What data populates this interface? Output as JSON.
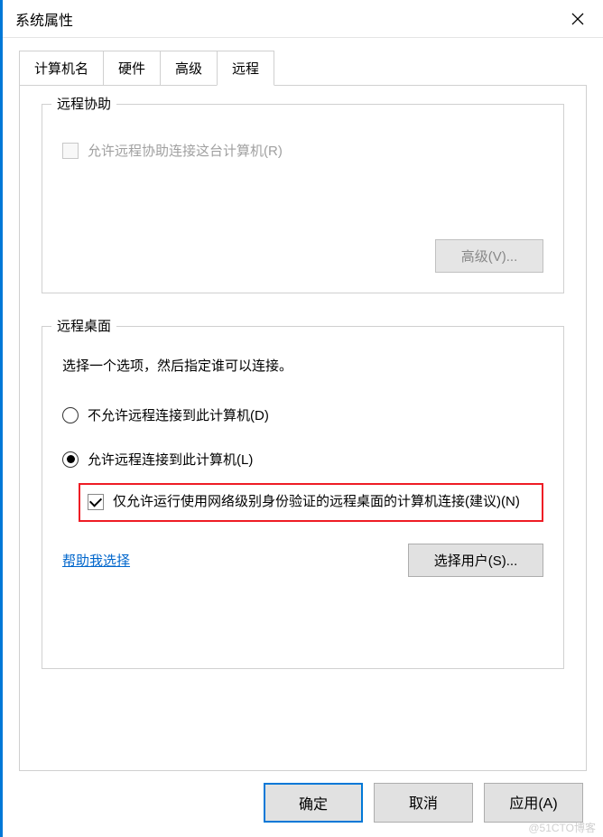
{
  "window": {
    "title": "系统属性"
  },
  "tabs": [
    {
      "label": "计算机名",
      "active": false
    },
    {
      "label": "硬件",
      "active": false
    },
    {
      "label": "高级",
      "active": false
    },
    {
      "label": "远程",
      "active": true
    }
  ],
  "remote_assist": {
    "group_title": "远程协助",
    "allow_label": "允许远程协助连接这台计算机(R)",
    "advanced_btn": "高级(V)..."
  },
  "remote_desktop": {
    "group_title": "远程桌面",
    "description": "选择一个选项，然后指定谁可以连接。",
    "opt_disallow": "不允许远程连接到此计算机(D)",
    "opt_allow": "允许远程连接到此计算机(L)",
    "nla_label": "仅允许运行使用网络级别身份验证的远程桌面的计算机连接(建议)(N)",
    "help_link": "帮助我选择",
    "select_users_btn": "选择用户(S)..."
  },
  "buttons": {
    "ok": "确定",
    "cancel": "取消",
    "apply": "应用(A)"
  },
  "watermark": "@51CTO博客"
}
